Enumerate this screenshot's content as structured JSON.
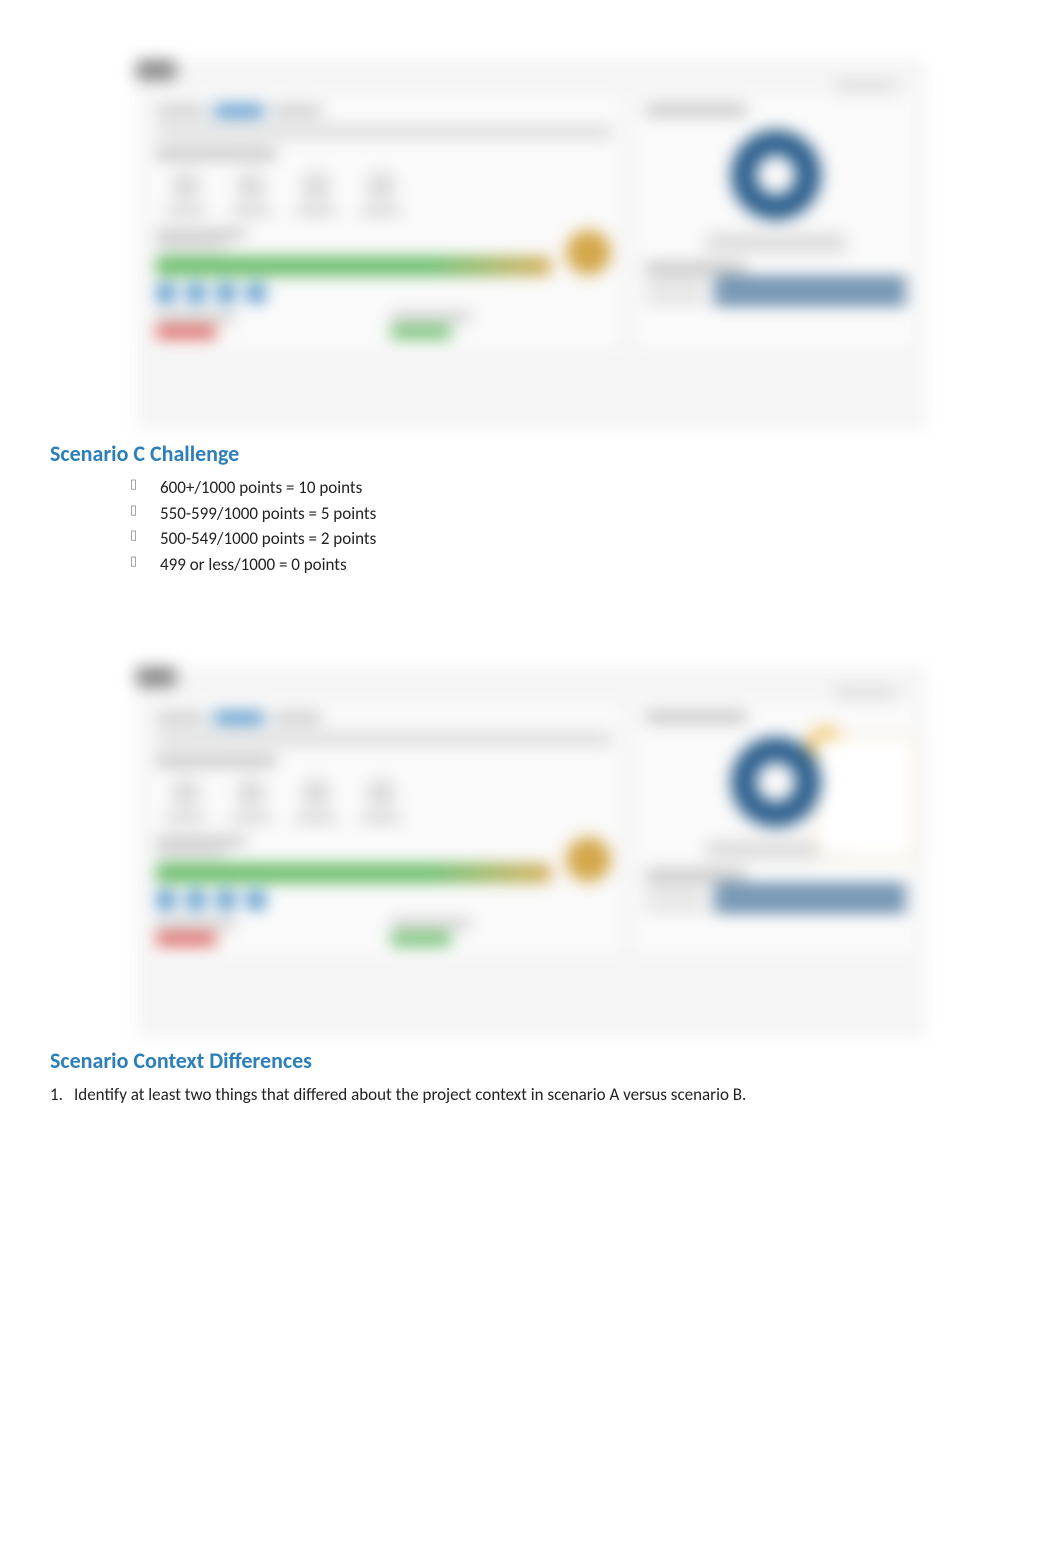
{
  "section1": {
    "heading": "Scenario C Challenge",
    "bullets": [
      "600+/1000 points = 10 points",
      "550-599/1000 points = 5 points",
      "500-549/1000 points = 2 points",
      "499 or less/1000 = 0 points"
    ]
  },
  "section2": {
    "heading": "Scenario Context Differences",
    "items": [
      {
        "num": "1.",
        "text": "Identify at least two things that differed about the project context in scenario A versus scenario B."
      }
    ]
  }
}
